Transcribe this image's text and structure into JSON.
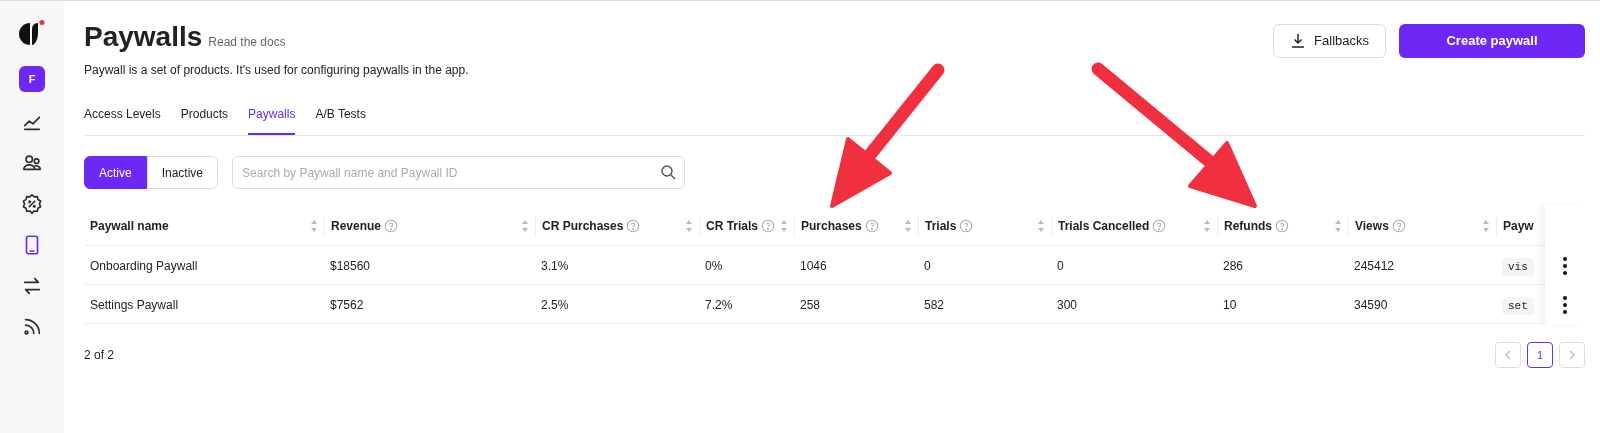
{
  "sidebar": {
    "avatar": "F",
    "items": [
      {
        "kind": "chart",
        "selected": false
      },
      {
        "kind": "users",
        "selected": false
      },
      {
        "kind": "percent",
        "selected": false
      },
      {
        "kind": "phone",
        "selected": true
      },
      {
        "kind": "transfer",
        "selected": false
      },
      {
        "kind": "feed",
        "selected": false
      }
    ]
  },
  "header": {
    "title": "Paywalls",
    "docs_link": "Read the docs",
    "description": "Paywall is a set of products. It's used for configuring paywalls in the app.",
    "fallbacks_button": "Fallbacks",
    "create_button": "Create paywall"
  },
  "tabs": [
    {
      "label": "Access Levels",
      "selected": false
    },
    {
      "label": "Products",
      "selected": false
    },
    {
      "label": "Paywalls",
      "selected": true
    },
    {
      "label": "A/B Tests",
      "selected": false
    }
  ],
  "filter": [
    {
      "label": "Active",
      "selected": true
    },
    {
      "label": "Inactive",
      "selected": false
    }
  ],
  "search": {
    "placeholder": "Search by Paywall name and Paywall ID"
  },
  "table": {
    "columns": [
      {
        "label": "Paywall name",
        "help": false
      },
      {
        "label": "Revenue",
        "help": true
      },
      {
        "label": "CR Purchases",
        "help": true
      },
      {
        "label": "CR Trials",
        "help": true
      },
      {
        "label": "Purchases",
        "help": true
      },
      {
        "label": "Trials",
        "help": true
      },
      {
        "label": "Trials Cancelled",
        "help": true
      },
      {
        "label": "Refunds",
        "help": true
      },
      {
        "label": "Views",
        "help": true
      },
      {
        "label": "Payw",
        "help": false
      }
    ],
    "rows": [
      {
        "cells": [
          "Onboarding Paywall",
          "$18560",
          "3.1%",
          "0%",
          "1046",
          "0",
          "0",
          "286",
          "245412",
          "vis"
        ]
      },
      {
        "cells": [
          "Settings Paywall",
          "$7562",
          "2.5%",
          "7.2%",
          "258",
          "582",
          "300",
          "10",
          "34590",
          "set"
        ]
      }
    ]
  },
  "footer": {
    "count": "2 of 2",
    "pages": [
      {
        "label": "1",
        "selected": true
      }
    ]
  }
}
